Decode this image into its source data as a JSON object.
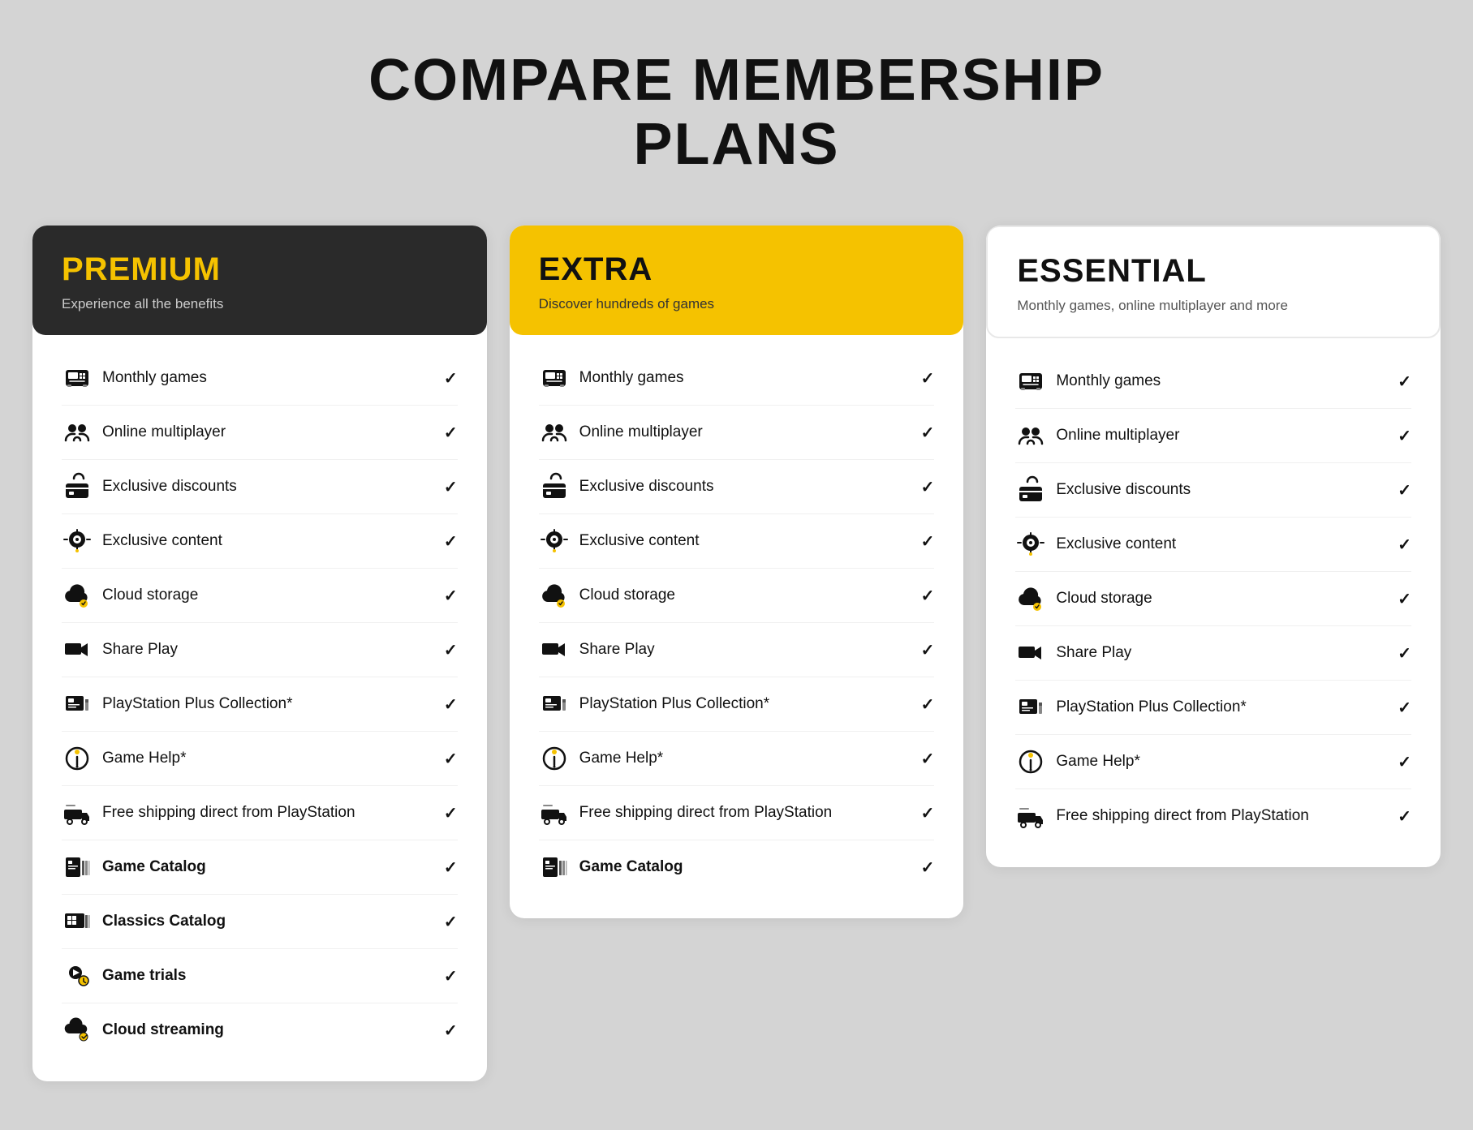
{
  "page": {
    "title_line1": "COMPARE MEMBERSHIP",
    "title_line2": "PLANS"
  },
  "plans": [
    {
      "id": "premium",
      "name": "PREMIUM",
      "subtitle": "Experience all the benefits",
      "header_style": "premium",
      "features": [
        {
          "label": "Monthly games",
          "bold": false,
          "icon": "🎮"
        },
        {
          "label": "Online multiplayer",
          "bold": false,
          "icon": "👥"
        },
        {
          "label": "Exclusive discounts",
          "bold": false,
          "icon": "🏷️"
        },
        {
          "label": "Exclusive content",
          "bold": false,
          "icon": "⚙️"
        },
        {
          "label": "Cloud storage",
          "bold": false,
          "icon": "☁️"
        },
        {
          "label": "Share Play",
          "bold": false,
          "icon": "🎮"
        },
        {
          "label": "PlayStation Plus Collection*",
          "bold": false,
          "icon": "🗂️"
        },
        {
          "label": "Game Help*",
          "bold": false,
          "icon": "💡"
        },
        {
          "label": "Free shipping direct from PlayStation",
          "bold": false,
          "icon": "🚚"
        },
        {
          "label": "Game Catalog",
          "bold": true,
          "icon": "📋"
        },
        {
          "label": "Classics Catalog",
          "bold": true,
          "icon": "📺"
        },
        {
          "label": "Game trials",
          "bold": true,
          "icon": "🎮"
        },
        {
          "label": "Cloud streaming",
          "bold": true,
          "icon": "☁️"
        }
      ]
    },
    {
      "id": "extra",
      "name": "EXTRA",
      "subtitle": "Discover hundreds of games",
      "header_style": "extra",
      "features": [
        {
          "label": "Monthly games",
          "bold": false,
          "icon": "🎮"
        },
        {
          "label": "Online multiplayer",
          "bold": false,
          "icon": "👥"
        },
        {
          "label": "Exclusive discounts",
          "bold": false,
          "icon": "🏷️"
        },
        {
          "label": "Exclusive content",
          "bold": false,
          "icon": "⚙️"
        },
        {
          "label": "Cloud storage",
          "bold": false,
          "icon": "☁️"
        },
        {
          "label": "Share Play",
          "bold": false,
          "icon": "🎮"
        },
        {
          "label": "PlayStation Plus Collection*",
          "bold": false,
          "icon": "🗂️"
        },
        {
          "label": "Game Help*",
          "bold": false,
          "icon": "💡"
        },
        {
          "label": "Free shipping direct from PlayStation",
          "bold": false,
          "icon": "🚚"
        },
        {
          "label": "Game Catalog",
          "bold": true,
          "icon": "📋"
        }
      ]
    },
    {
      "id": "essential",
      "name": "ESSENTIAL",
      "subtitle": "Monthly games, online multiplayer and more",
      "header_style": "essential",
      "features": [
        {
          "label": "Monthly games",
          "bold": false,
          "icon": "🎮"
        },
        {
          "label": "Online multiplayer",
          "bold": false,
          "icon": "👥"
        },
        {
          "label": "Exclusive discounts",
          "bold": false,
          "icon": "🏷️"
        },
        {
          "label": "Exclusive content",
          "bold": false,
          "icon": "⚙️"
        },
        {
          "label": "Cloud storage",
          "bold": false,
          "icon": "☁️"
        },
        {
          "label": "Share Play",
          "bold": false,
          "icon": "🎮"
        },
        {
          "label": "PlayStation Plus Collection*",
          "bold": false,
          "icon": "🗂️"
        },
        {
          "label": "Game Help*",
          "bold": false,
          "icon": "💡"
        },
        {
          "label": "Free shipping direct from PlayStation",
          "bold": false,
          "icon": "🚚"
        }
      ]
    }
  ],
  "icons": {
    "monthly_games": "🎁",
    "online_multiplayer": "🤝",
    "exclusive_discounts": "🏷️",
    "exclusive_content": "⚙️",
    "cloud_storage": "☁️",
    "share_play": "🎮",
    "ps_collection": "📂",
    "game_help": "💡",
    "free_shipping": "🚛",
    "game_catalog": "📋",
    "classics_catalog": "📺",
    "game_trials": "🎯",
    "cloud_streaming": "📡",
    "check": "✓"
  }
}
